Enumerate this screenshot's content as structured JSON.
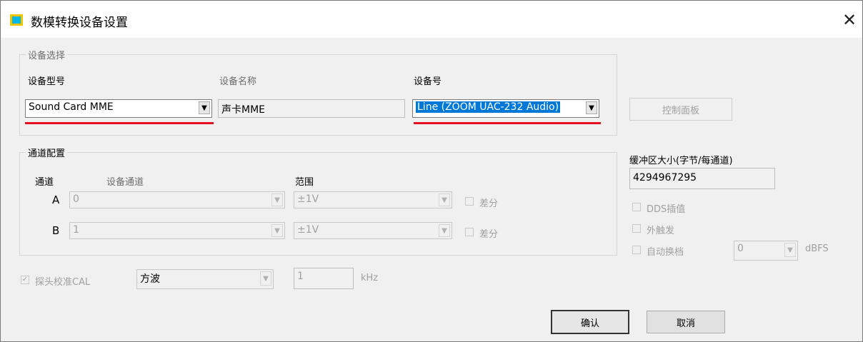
{
  "window": {
    "title": "数模转换设备设置",
    "icon": "app-icon",
    "accent": "#0078d7",
    "highlight_color": "#e81123"
  },
  "device_group": {
    "legend": "设备选择",
    "model_label": "设备型号",
    "model_value": "Sound Card MME",
    "name_label": "设备名称",
    "name_value": "声卡MME",
    "number_label": "设备号",
    "number_value": "Line (ZOOM UAC-232 Audio)",
    "control_panel": "控制面板"
  },
  "channel_group": {
    "legend": "通道配置",
    "col_channel": "通道",
    "col_device_channel": "设备通道",
    "col_range": "范围",
    "rows": [
      {
        "channel": "A",
        "device_channel": "0",
        "range": "±1V",
        "diff_label": "差分"
      },
      {
        "channel": "B",
        "device_channel": "1",
        "range": "±1V",
        "diff_label": "差分"
      }
    ]
  },
  "buffer": {
    "label": "缓冲区大小(字节/每通道)",
    "value": "4294967295",
    "dds_label": "DDS插值",
    "ext_trigger_label": "外触发",
    "auto_range_label": "自动换档",
    "auto_range_value": "0",
    "unit": "dBFS"
  },
  "probe": {
    "label": "探头校准CAL",
    "waveform": "方波",
    "freq_value": "1",
    "freq_unit": "kHz"
  },
  "buttons": {
    "ok": "确认",
    "cancel": "取消"
  }
}
